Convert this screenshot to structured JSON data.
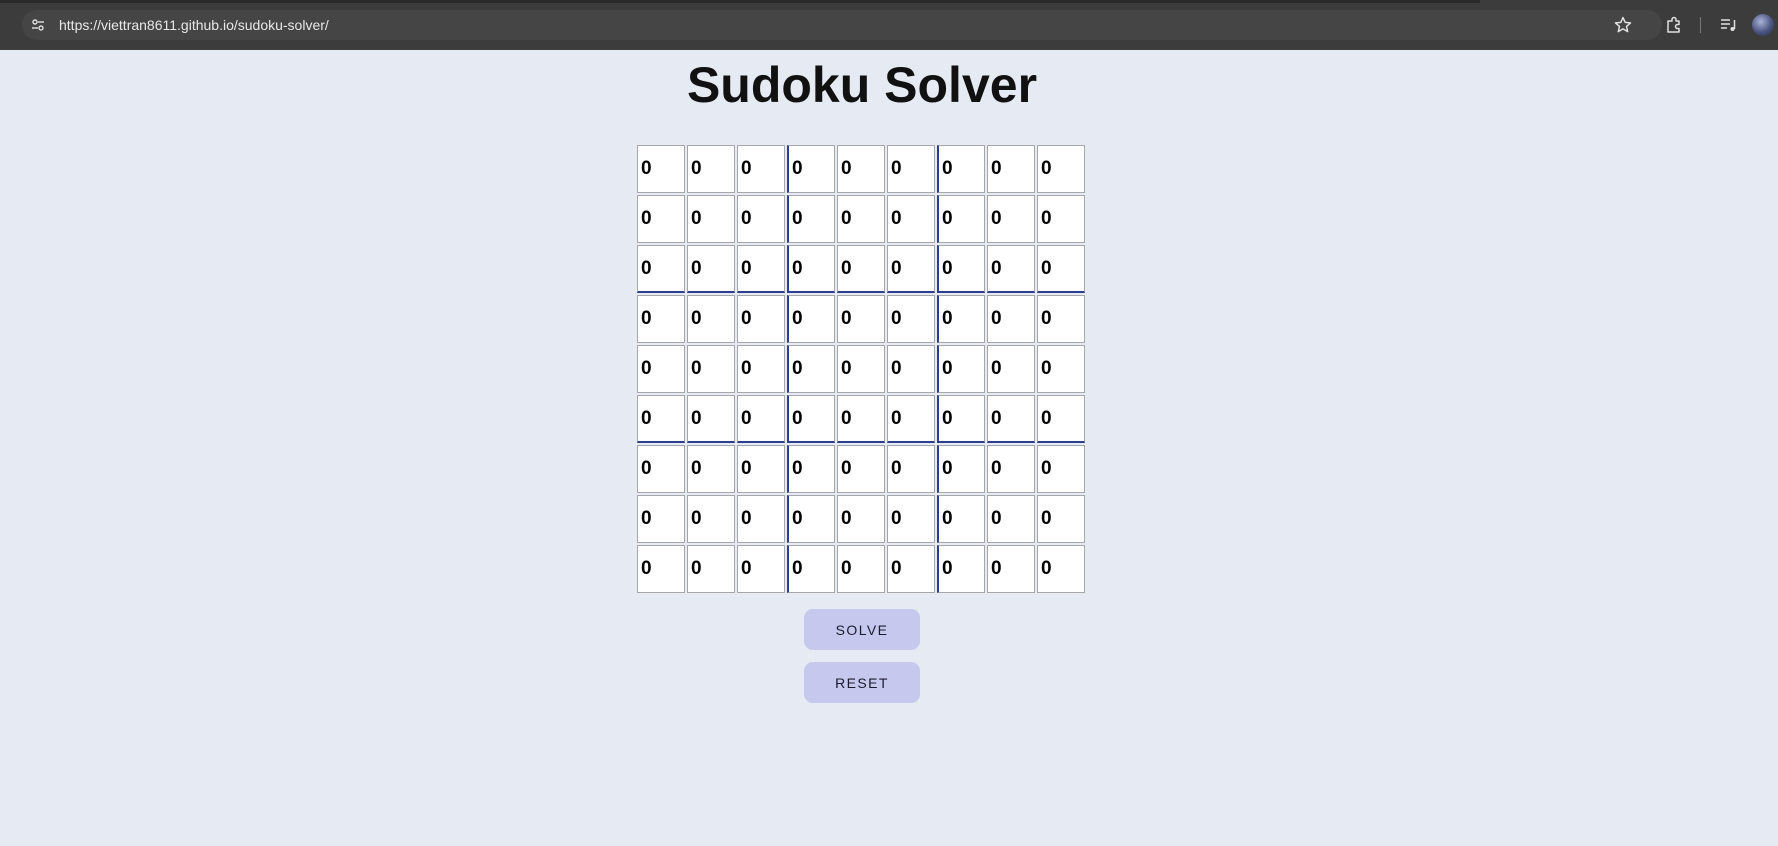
{
  "browser": {
    "url": "https://viettran8611.github.io/sudoku-solver/",
    "icons": [
      "site-info-icon",
      "bookmark-star-icon",
      "extensions-icon",
      "media-controls-icon",
      "profile-avatar-icon"
    ]
  },
  "page": {
    "title": "Sudoku Solver"
  },
  "grid": {
    "rows": [
      [
        "0",
        "0",
        "0",
        "0",
        "0",
        "0",
        "0",
        "0",
        "0"
      ],
      [
        "0",
        "0",
        "0",
        "0",
        "0",
        "0",
        "0",
        "0",
        "0"
      ],
      [
        "0",
        "0",
        "0",
        "0",
        "0",
        "0",
        "0",
        "0",
        "0"
      ],
      [
        "0",
        "0",
        "0",
        "0",
        "0",
        "0",
        "0",
        "0",
        "0"
      ],
      [
        "0",
        "0",
        "0",
        "0",
        "0",
        "0",
        "0",
        "0",
        "0"
      ],
      [
        "0",
        "0",
        "0",
        "0",
        "0",
        "0",
        "0",
        "0",
        "0"
      ],
      [
        "0",
        "0",
        "0",
        "0",
        "0",
        "0",
        "0",
        "0",
        "0"
      ],
      [
        "0",
        "0",
        "0",
        "0",
        "0",
        "0",
        "0",
        "0",
        "0"
      ],
      [
        "0",
        "0",
        "0",
        "0",
        "0",
        "0",
        "0",
        "0",
        "0"
      ]
    ]
  },
  "buttons": {
    "solve_label": "SOLVE",
    "reset_label": "RESET"
  },
  "colors": {
    "page_background": "#e6eaf2",
    "box_border": "#2b3f8c",
    "button_background": "#c6c8ee",
    "browser_chrome": "#3c3c3c"
  }
}
